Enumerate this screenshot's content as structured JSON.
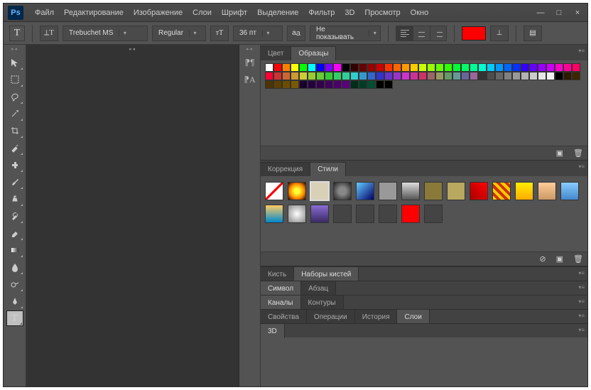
{
  "menubar": [
    "Файл",
    "Редактирование",
    "Изображение",
    "Слои",
    "Шрифт",
    "Выделение",
    "Фильтр",
    "3D",
    "Просмотр",
    "Окно"
  ],
  "options": {
    "font_family": "Trebuchet MS",
    "font_style": "Regular",
    "font_size": "36 пт",
    "antialias": "Не показывать",
    "text_color": "#ff0000"
  },
  "color_panel": {
    "tabs": [
      "Цвет",
      "Образцы"
    ],
    "active": 1,
    "swatches": [
      "#ffffff",
      "#ff0000",
      "#ff7f00",
      "#ffff00",
      "#00ff00",
      "#00ffff",
      "#0000ff",
      "#7f00ff",
      "#ff00ff",
      "#000000",
      "#330000",
      "#660000",
      "#990000",
      "#cc0000",
      "#ff3300",
      "#ff6600",
      "#ff9900",
      "#ffcc00",
      "#ccff00",
      "#99ff00",
      "#66ff00",
      "#33ff00",
      "#00ff33",
      "#00ff66",
      "#00ff99",
      "#00ffcc",
      "#00ccff",
      "#0099ff",
      "#0066ff",
      "#0033ff",
      "#3300ff",
      "#6600ff",
      "#9900ff",
      "#cc00ff",
      "#ff00cc",
      "#ff0099",
      "#ff0066",
      "#ff0033",
      "#cc3333",
      "#cc6633",
      "#cc9933",
      "#cccc33",
      "#99cc33",
      "#66cc33",
      "#33cc33",
      "#33cc66",
      "#33cc99",
      "#33cccc",
      "#3399cc",
      "#3366cc",
      "#3333cc",
      "#6633cc",
      "#9933cc",
      "#cc33cc",
      "#cc3399",
      "#cc3366",
      "#996666",
      "#999966",
      "#669966",
      "#669999",
      "#666699",
      "#996699",
      "#333333",
      "#4d4d4d",
      "#666666",
      "#808080",
      "#999999",
      "#b3b3b3",
      "#cccccc",
      "#e6e6e6",
      "#f2f2f2",
      "#000000",
      "#2e1a00",
      "#3d2600",
      "#4d3300",
      "#5c4000",
      "#6b4d00",
      "#7a5900",
      "#1a002e",
      "#26003d",
      "#33004d",
      "#40005c",
      "#4d006b",
      "#59007a",
      "#002e1a",
      "#003d26",
      "#004d33",
      "#000000",
      "#000000"
    ]
  },
  "correction_panel": {
    "tabs": [
      "Коррекция",
      "Стили"
    ],
    "active": 1,
    "styles": [
      {
        "bg": "linear-gradient(135deg,#fff 45%,#f00 45%,#f00 55%,#fff 55%)"
      },
      {
        "bg": "radial-gradient(circle,#ff3 20%,#f80 60%,#200 100%)"
      },
      {
        "bg": "#d9d0b8",
        "sel": true
      },
      {
        "bg": "radial-gradient(circle,#888 30%,#222 100%)"
      },
      {
        "bg": "linear-gradient(135deg,#6cf,#006)"
      },
      {
        "bg": "#999"
      },
      {
        "bg": "linear-gradient(#ddd,#555)"
      },
      {
        "bg": "#8a7a3a"
      },
      {
        "bg": "#b8a860"
      },
      {
        "bg": "linear-gradient(45deg,#a00,#f00)"
      },
      {
        "bg": "repeating-linear-gradient(45deg,#fc0 0 4px,#c30 4px 8px)"
      },
      {
        "bg": "linear-gradient(#fe0,#fa0)"
      },
      {
        "bg": "linear-gradient(#fc9,#c96)"
      },
      {
        "bg": "linear-gradient(#8cf,#48c)"
      },
      {
        "bg": "linear-gradient(#fc6,#08c)"
      },
      {
        "bg": "radial-gradient(circle,#fff,#888)"
      },
      {
        "bg": "linear-gradient(#8a6cd4,#3a2a64)"
      },
      {
        "bg": "#444"
      },
      {
        "bg": "#444"
      },
      {
        "bg": "#444"
      },
      {
        "bg": "#ff0000"
      },
      {
        "bg": "#444"
      }
    ]
  },
  "brush_panel": {
    "tabs": [
      "Кисть",
      "Наборы кистей"
    ],
    "active": 1
  },
  "char_panel": {
    "tabs": [
      "Символ",
      "Абзац"
    ],
    "active": 0
  },
  "chan_panel": {
    "tabs": [
      "Каналы",
      "Контуры"
    ],
    "active": 0
  },
  "layers_panel": {
    "tabs": [
      "Свойства",
      "Операции",
      "История",
      "Слои"
    ],
    "active": 3
  },
  "d3_panel": {
    "tabs": [
      "3D"
    ],
    "active": 0
  }
}
